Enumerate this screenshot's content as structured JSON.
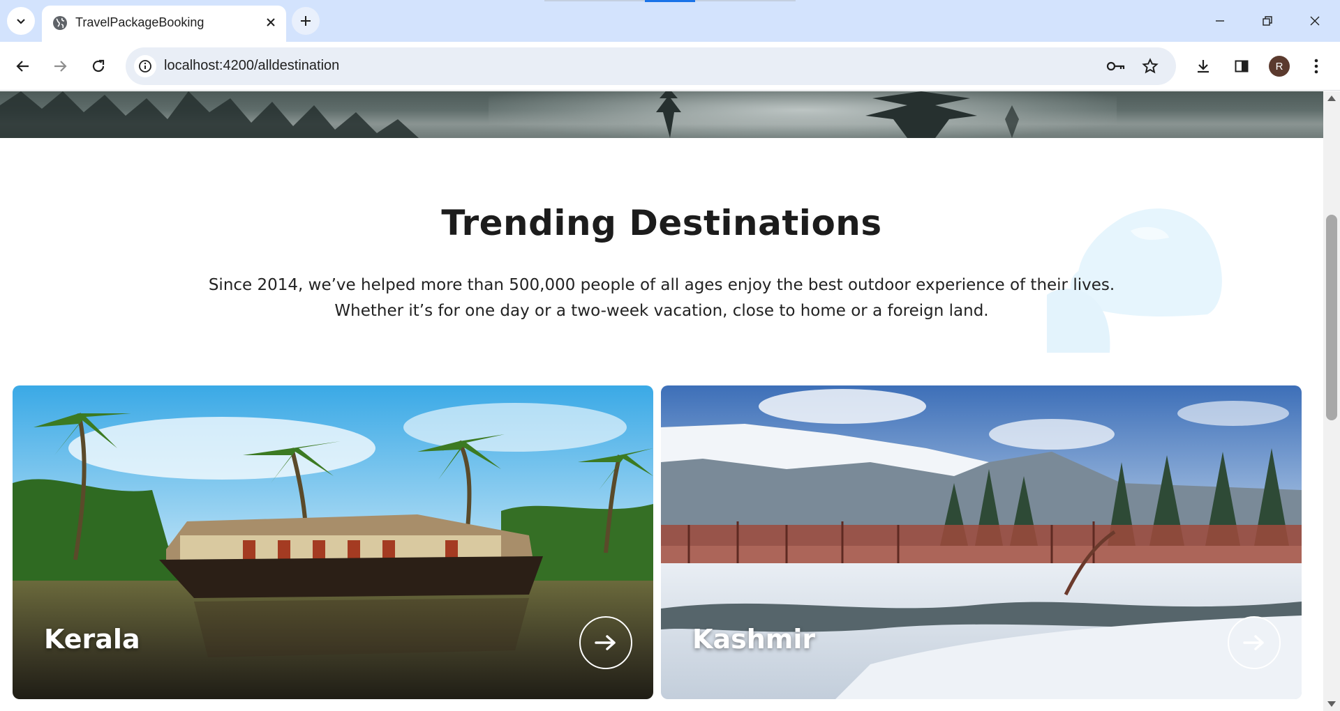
{
  "browser": {
    "tab_title": "TravelPackageBooking",
    "url": "localhost:4200/alldestination",
    "profile_initial": "R",
    "accent": "#1a73e8"
  },
  "section": {
    "title": "Trending Destinations",
    "description": "Since 2014, we’ve helped more than 500,000 people of all ages enjoy the best outdoor experience of their lives. Whether it’s for one day or a two-week vacation, close to home or a foreign land."
  },
  "destinations": [
    {
      "name": "Kerala",
      "icon": "arrow-right-icon"
    },
    {
      "name": "Kashmir",
      "icon": "arrow-right-icon"
    }
  ]
}
